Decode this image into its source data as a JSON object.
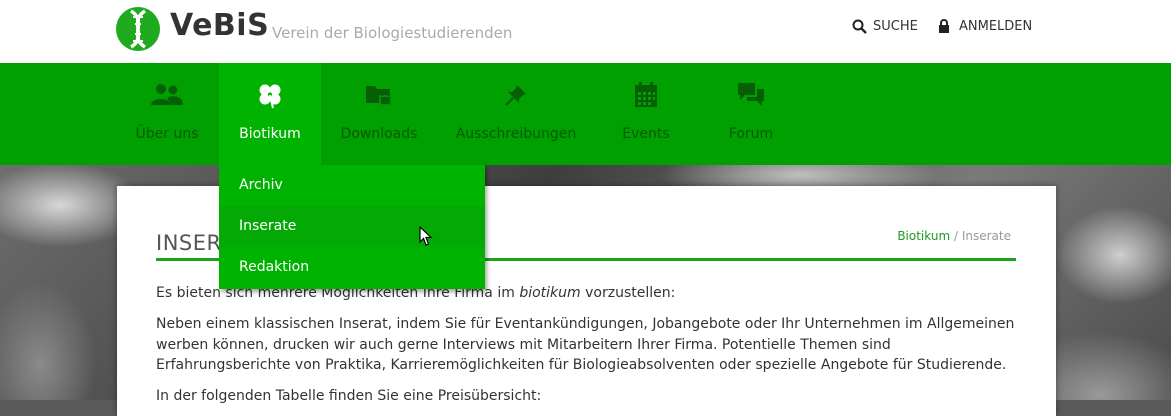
{
  "header": {
    "brand": "VeBiS",
    "tagline": "Verein der Biologiestudierenden",
    "search_label": "SUCHE",
    "login_label": "ANMELDEN"
  },
  "nav": {
    "items": [
      {
        "label": "Über uns",
        "icon": "users-icon"
      },
      {
        "label": "Biotikum",
        "icon": "clover-icon",
        "active": true
      },
      {
        "label": "Downloads",
        "icon": "folder-lock-icon"
      },
      {
        "label": "Ausschreibungen",
        "icon": "pin-icon"
      },
      {
        "label": "Events",
        "icon": "calendar-icon"
      },
      {
        "label": "Forum",
        "icon": "chat-icon"
      }
    ],
    "dropdown": [
      "Archiv",
      "Inserate",
      "Redaktion"
    ]
  },
  "page": {
    "title": "INSERATE",
    "breadcrumb_root": "Biotikum",
    "breadcrumb_sep": "/",
    "breadcrumb_current": "Inserate",
    "p1_pre": "Es bieten sich mehrere Möglichkeiten Ihre Firma im ",
    "p1_em": "biotikum",
    "p1_post": " vorzustellen:",
    "p2": "Neben einem klassischen Inserat, indem Sie für Eventankündigungen, Jobangebote oder Ihr Unternehmen im Allgemeinen werben können, drucken wir auch gerne Interviews mit Mitarbeitern Ihrer Firma. Potentielle Themen sind Erfahrungsberichte von Praktika, Karrieremöglichkeiten für Biologieabsolventen oder spezielle Angebote für Studierende.",
    "p3": "In der folgenden Tabelle finden Sie eine Preisübersicht:"
  },
  "colors": {
    "nav_green": "#00a000",
    "active_green": "#00b300",
    "accent": "#1aa51a"
  }
}
